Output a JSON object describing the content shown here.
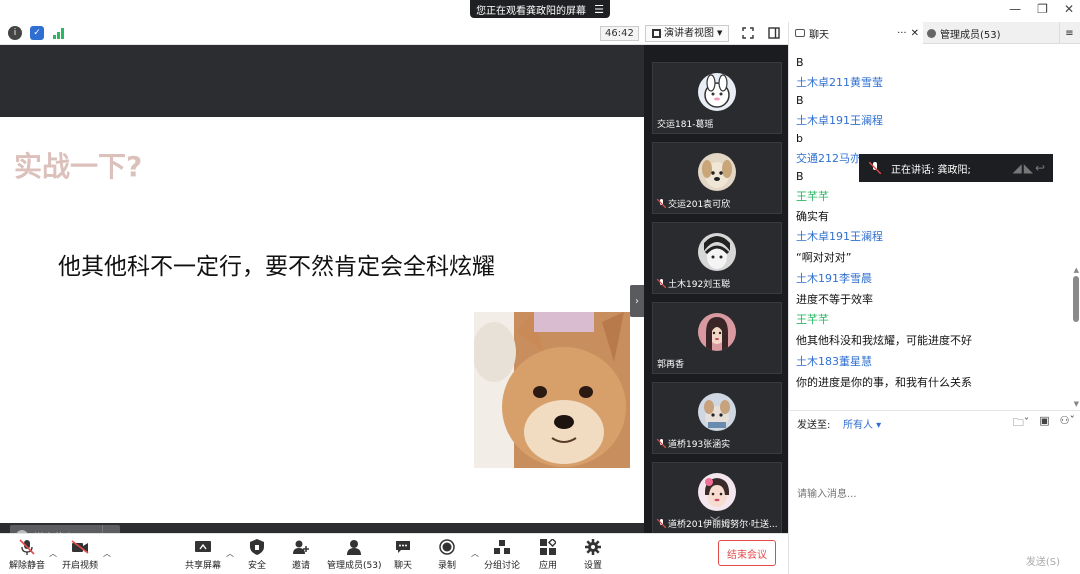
{
  "share_banner": {
    "text": "您正在观看龚政阳的屏幕"
  },
  "top_toolbar": {
    "timer": "46:42",
    "view_label": "演讲者视图"
  },
  "slide": {
    "title": "实战一下?",
    "body": "他其他科不一定行，要不然肯定会全科炫耀"
  },
  "say_box": {
    "placeholder": "说点什么..."
  },
  "gallery": {
    "tiles": [
      {
        "name": "交运181-葛瑶",
        "muted": false
      },
      {
        "name": "交运201袁可欣",
        "muted": true
      },
      {
        "name": "土木192刘玉聪",
        "muted": true
      },
      {
        "name": "郭再香",
        "muted": false
      },
      {
        "name": "道桥193张涵实",
        "muted": true
      },
      {
        "name": "道桥201伊丽姆努尔·吐送...",
        "muted": true
      }
    ]
  },
  "chat": {
    "tab_chat": "聊天",
    "tab_members": "管理成员(53)",
    "messages": [
      {
        "kind": "text",
        "text": "B"
      },
      {
        "kind": "sender",
        "text": "土木卓211黄雪莹"
      },
      {
        "kind": "text",
        "text": "B"
      },
      {
        "kind": "sender",
        "text": "土木卓191王澜程"
      },
      {
        "kind": "text",
        "text": "b"
      },
      {
        "kind": "sender",
        "text": "交通212马亦"
      },
      {
        "kind": "text",
        "text": "B"
      },
      {
        "kind": "sender-green",
        "text": "王芊芊"
      },
      {
        "kind": "text",
        "text": "确实有"
      },
      {
        "kind": "sender",
        "text": "土木卓191王澜程"
      },
      {
        "kind": "text",
        "text": "“啊对对对”"
      },
      {
        "kind": "sender",
        "text": "土木191李雪晨"
      },
      {
        "kind": "text",
        "text": "进度不等于效率"
      },
      {
        "kind": "sender-green",
        "text": "王芊芊"
      },
      {
        "kind": "text",
        "text": "他其他科没和我炫耀，可能进度不好"
      },
      {
        "kind": "sender",
        "text": "土木183董星慧"
      },
      {
        "kind": "text",
        "text": "你的进度是你的事，和我有什么关系"
      }
    ],
    "speaking_label": "正在讲话: 龚政阳;",
    "send_to_label": "发送至:",
    "send_target": "所有人",
    "input_placeholder": "请输入消息...",
    "send_button": "发送(S)"
  },
  "bottom_toolbar": {
    "unmute": "解除静音",
    "start_video": "开启视频",
    "share_screen": "共享屏幕",
    "security": "安全",
    "invite": "邀请",
    "members": "管理成员(53)",
    "chat": "聊天",
    "record": "录制",
    "breakout": "分组讨论",
    "apps": "应用",
    "settings": "设置",
    "end_meeting": "结束会议"
  },
  "colors": {
    "accent_blue": "#2f6fd2",
    "green_sender": "#2cb765",
    "end_red": "#e34b4b",
    "slide_title": "#dcc0bb"
  }
}
